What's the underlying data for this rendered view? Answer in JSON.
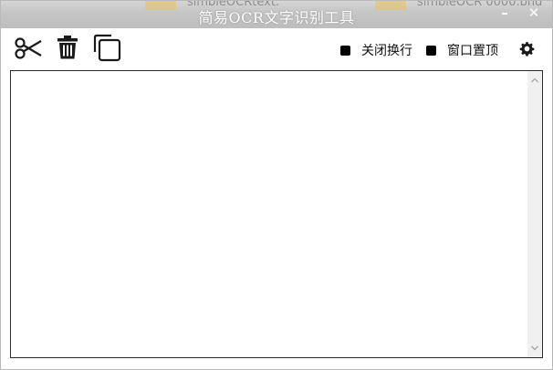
{
  "window": {
    "title": "简易OCR文字识别工具",
    "minimize_label": "–",
    "close_label": "✕"
  },
  "background": {
    "left_text": "simbleOCRtext.",
    "right_text": "simbleOCR 0000.bnd"
  },
  "toolbar": {
    "screenshot_icon": "scissors-icon",
    "clear_icon": "trash-icon",
    "copy_icon": "copy-icon",
    "toggles": [
      {
        "label": "关闭换行"
      },
      {
        "label": "窗口置顶"
      }
    ],
    "settings_icon": "gear-icon"
  },
  "editor": {
    "value": ""
  },
  "colors": {
    "titlebar": "#c6c6c6",
    "title_text": "#ffffff",
    "icon": "#1a1a1a",
    "border": "#2b2b2b",
    "scrollbar": "#f0f0f0"
  }
}
